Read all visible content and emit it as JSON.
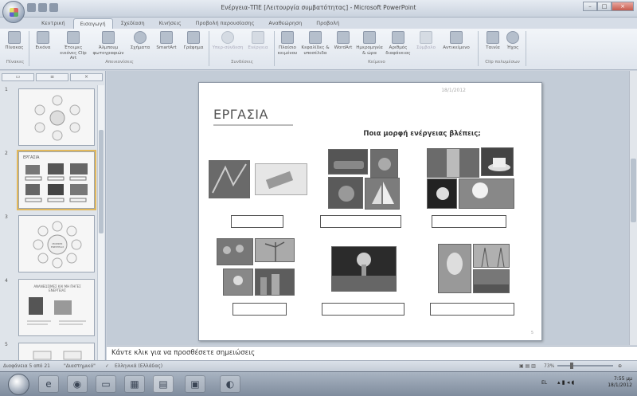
{
  "window": {
    "title": "Ενέργεια-ΤΠΕ [Λειτουργία συμβατότητας] - Microsoft PowerPoint"
  },
  "tabs": [
    "Κεντρική",
    "Εισαγωγή",
    "Σχεδίαση",
    "Κινήσεις",
    "Προβολή παρουσίασης",
    "Αναθεώρηση",
    "Προβολή"
  ],
  "active_tab": "Εισαγωγή",
  "ribbon": {
    "buttons": [
      {
        "label": "Πίνακας",
        "icon": "table-icon"
      },
      {
        "label": "Εικόνα",
        "icon": "picture-icon"
      },
      {
        "label": "Έτοιμες εικόνες Clip Art",
        "icon": "clipart-icon"
      },
      {
        "label": "Άλμπουμ φωτογραφιών",
        "icon": "photo-album-icon"
      },
      {
        "label": "Σχήματα",
        "icon": "shapes-icon"
      },
      {
        "label": "SmartArt",
        "icon": "smartart-icon"
      },
      {
        "label": "Γράφημα",
        "icon": "chart-icon"
      },
      {
        "label": "Υπερ-σύνδεση",
        "icon": "hyperlink-icon"
      },
      {
        "label": "Ενέργεια",
        "icon": "action-icon"
      },
      {
        "label": "Πλαίσιο κειμένου",
        "icon": "textbox-icon"
      },
      {
        "label": "Κεφαλίδες & υποσέλιδα",
        "icon": "header-footer-icon"
      },
      {
        "label": "WordArt",
        "icon": "wordart-icon"
      },
      {
        "label": "Ημερομηνία & ώρα",
        "icon": "date-time-icon"
      },
      {
        "label": "Αριθμός διαφάνειας",
        "icon": "slide-number-icon"
      },
      {
        "label": "Σύμβολο",
        "icon": "symbol-icon"
      },
      {
        "label": "Αντικείμενο",
        "icon": "object-icon"
      },
      {
        "label": "Ταινία",
        "icon": "movie-icon"
      },
      {
        "label": "Ήχος",
        "icon": "sound-icon"
      }
    ],
    "groups": [
      "Πίνακες",
      "Απεικονίσεις",
      "Συνδέσεις",
      "Κείμενο",
      "Clip πολυμέσων"
    ]
  },
  "slides_pane": {
    "thumb_numbers": [
      "1",
      "2",
      "3",
      "4",
      "5"
    ],
    "thumb2_title": "ΕΡΓΑΣΙΑ",
    "thumb3_text": "ΜΟΡΦΕΣ ΕΝΕΡΓΕΙΑΣ",
    "thumb4_title": "ΑΝΑΝΕΩΣΙΜΕΣ ΚΑΙ ΜΗ ΠΗΓΕΣ ΕΝΕΡΓΕΙΑΣ"
  },
  "slide": {
    "date": "18/1/2012",
    "title": "ΕΡΓΑΣΙΑ",
    "question": "Ποια μορφή ενέργειας βλέπεις;",
    "number": "5"
  },
  "notes": {
    "placeholder": "Κάντε κλικ για να προσθέσετε σημειώσεις"
  },
  "status": {
    "slide_info": "Διαφάνεια 5 από 21",
    "theme": "\"Διαστημικό\"",
    "language": "Ελληνικά (Ελλάδας)",
    "zoom": "73%"
  },
  "tray": {
    "lang": "EL",
    "time": "7:55 μμ",
    "date": "18/1/2012"
  },
  "colors": {
    "ribbon_bg": "#e9eef4",
    "slide_bg": "#ffffff",
    "selection": "#e2b85b"
  }
}
